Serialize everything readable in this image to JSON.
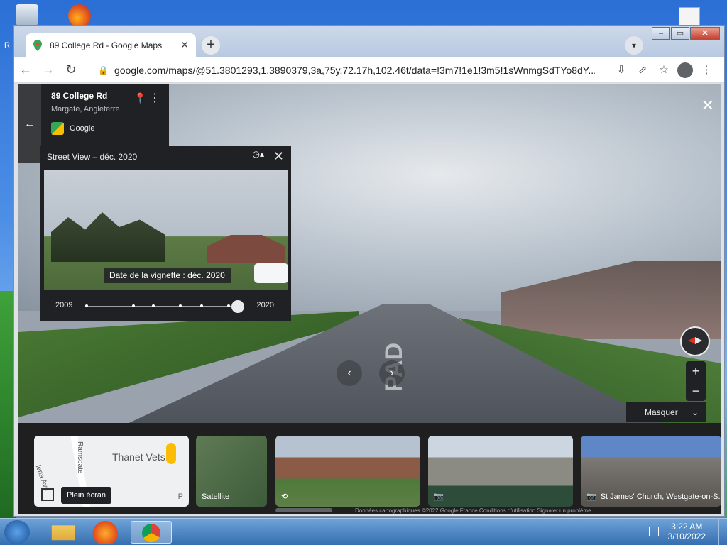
{
  "browser": {
    "tab_title": "89 College Rd - Google Maps",
    "tab_close": "✕",
    "new_tab": "+",
    "url": "google.com/maps/@51.3801293,1.3890379,3a,75y,72.17h,102.46t/data=!3m7!1e1!3m5!1sWnmgSdTYo8dY...",
    "window_controls": [
      "–",
      "▭",
      "✕"
    ]
  },
  "address_card": {
    "name": "89 College Rd",
    "city": "Margate, Angleterre",
    "brand": "Google"
  },
  "time_machine": {
    "title": "Street View – déc. 2020",
    "thumb_date": "Date de la vignette : déc. 2020",
    "year_start": "2009",
    "year_end": "2020",
    "slider_stops": 7,
    "selected_index": 6
  },
  "street": {
    "road_marking": "PAD"
  },
  "controls": {
    "masquer": "Masquer",
    "zoom_in": "+",
    "zoom_out": "−",
    "close": "✕"
  },
  "strip": {
    "map": {
      "vets": "Thanet Vets",
      "ramsgate": "Ramsgate",
      "ave": "lena Ave",
      "p": "P",
      "tooltip": "Plein écran"
    },
    "satellite": "Satellite",
    "photo3_caption": "St James' Church, Westgate-on-S...",
    "footer": "Données cartographiques ©2022 Google   France   Conditions d'utilisation   Signaler un problème"
  },
  "taskbar": {
    "time": "3:22 AM",
    "date": "3/10/2022"
  },
  "desktop": {
    "r_label": "R"
  }
}
